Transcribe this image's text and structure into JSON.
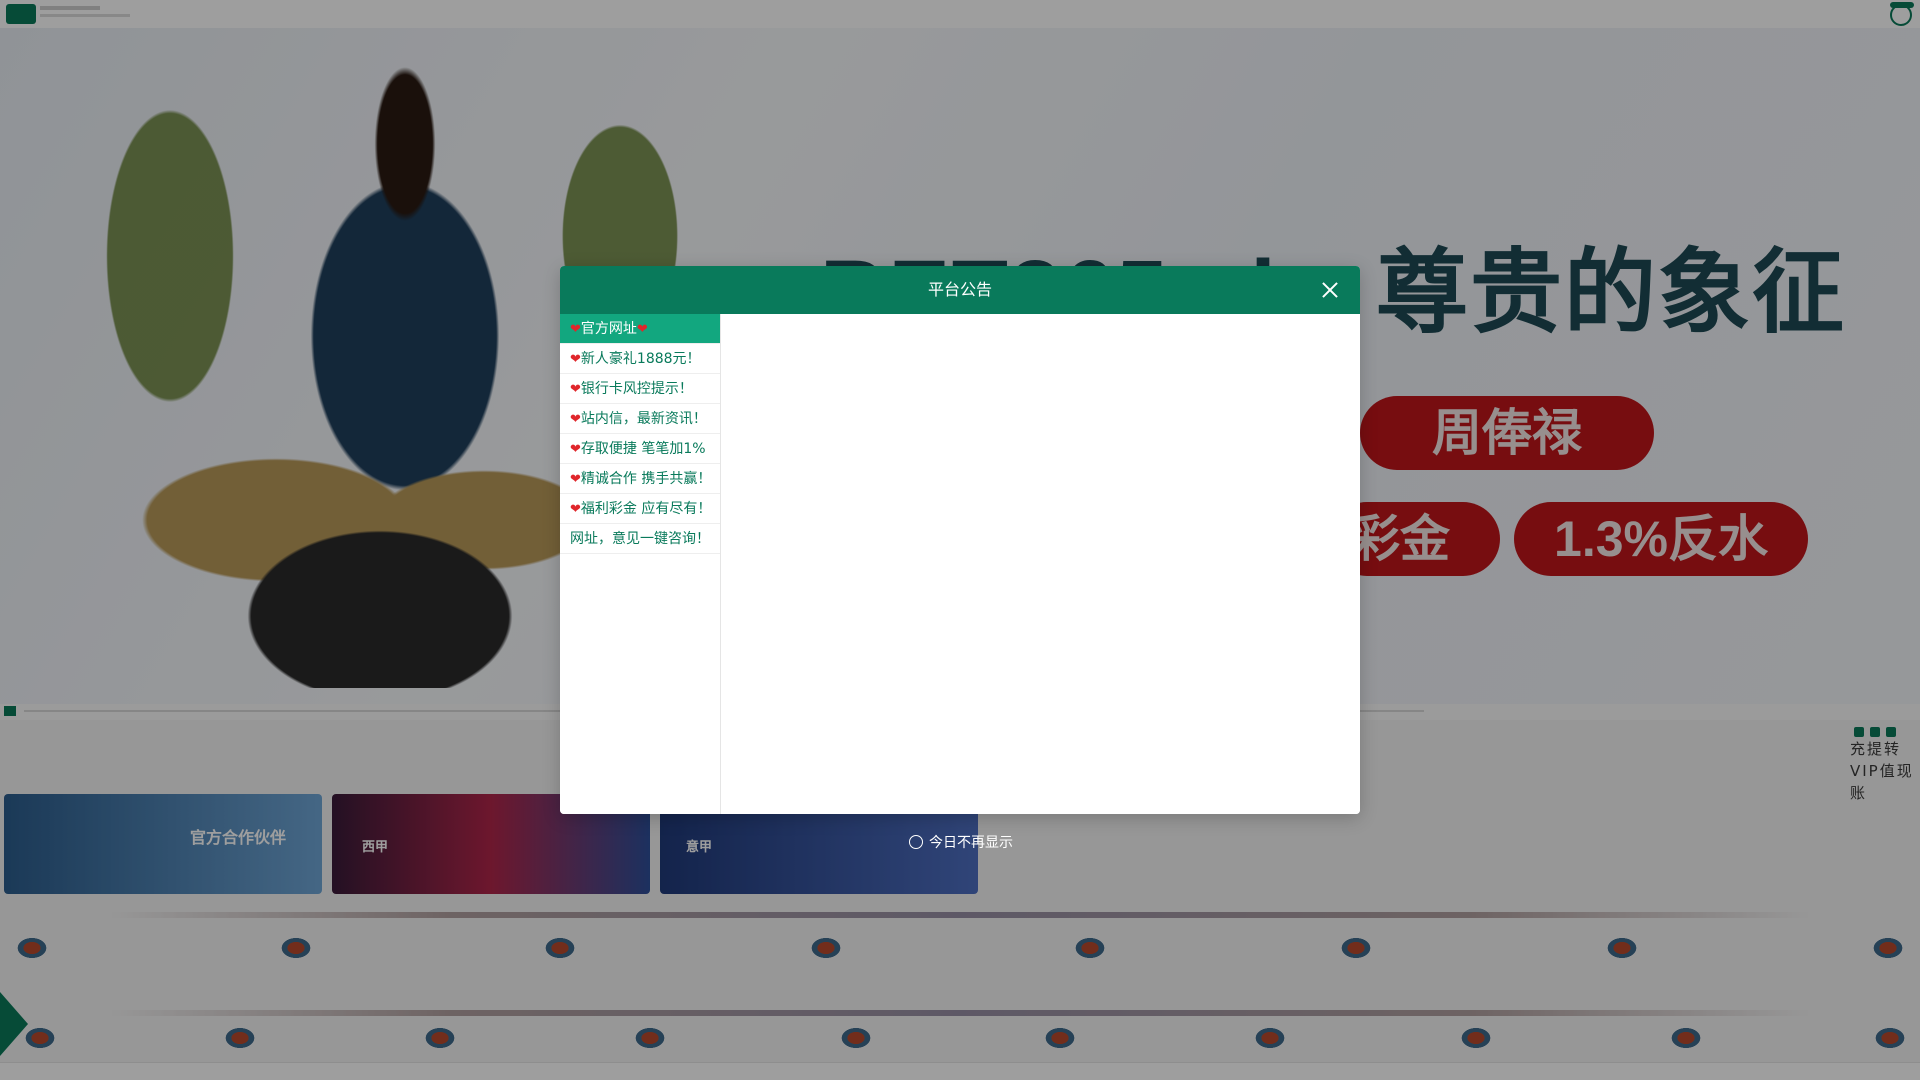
{
  "banner": {
    "title_latin": "BET365.vip",
    "title_cn": "尊贵的象征",
    "pills": [
      "周俸禄",
      "彩金",
      "1.3%反水"
    ]
  },
  "side_text": "充提转VIP值现账",
  "modal": {
    "title": "平台公告",
    "menu": [
      {
        "label": "官方网址",
        "heart_left": true,
        "heart_right": true,
        "active": true
      },
      {
        "label": "新人豪礼1888元！",
        "heart_left": true
      },
      {
        "label": "银行卡风控提示！",
        "heart_left": true
      },
      {
        "label": "站内信，最新资讯！",
        "heart_left": true
      },
      {
        "label": "存取便捷 笔笔加1%",
        "heart_left": true
      },
      {
        "label": "精诚合作 携手共赢！",
        "heart_left": true
      },
      {
        "label": "福利彩金 应有尽有！",
        "heart_left": true
      },
      {
        "label": "网址，意见一键咨询！",
        "heart_left": false
      }
    ],
    "dont_show_label": "今日不再显示"
  },
  "cards": [
    {
      "label": "官方合作伙伴"
    },
    {
      "label": "西甲"
    },
    {
      "label": "意甲"
    }
  ],
  "colors": {
    "primary": "#097a5b",
    "active_item": "#12a77f",
    "heart": "#e0262b",
    "pill_red": "#c0161b"
  }
}
